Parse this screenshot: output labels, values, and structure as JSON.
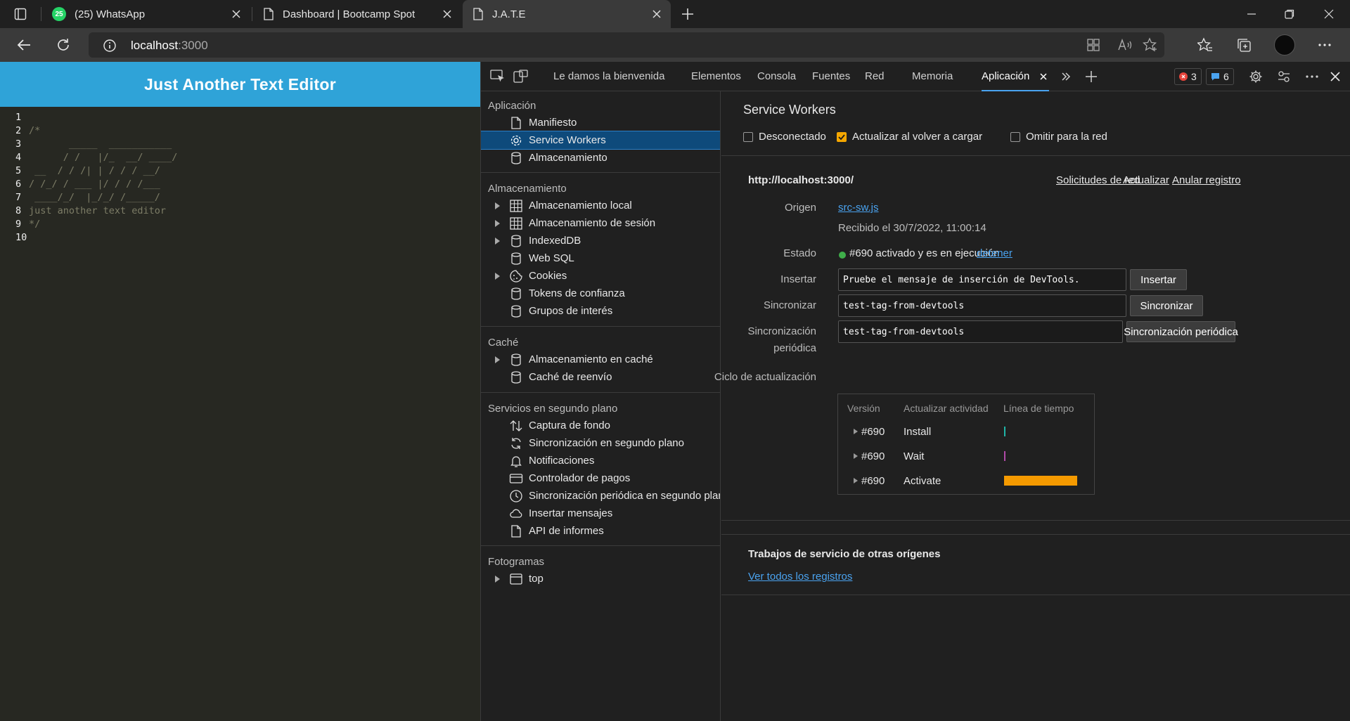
{
  "browser": {
    "tabs": [
      {
        "title": "(25) WhatsApp",
        "badge": "25"
      },
      {
        "title": "Dashboard | Bootcamp Spot"
      },
      {
        "title": "J.A.T.E"
      }
    ],
    "url_host": "localhost",
    "url_port": ":3000"
  },
  "app": {
    "header": "Just Another Text Editor",
    "code_lines": [
      {
        "n": "1",
        "t": ""
      },
      {
        "n": "2",
        "t": "/*"
      },
      {
        "n": "3",
        "t": "       _____  ___________"
      },
      {
        "n": "4",
        "t": "      / /   |/_  __/ ____/"
      },
      {
        "n": "5",
        "t": " __  / / /| | / / / __/"
      },
      {
        "n": "6",
        "t": "/ /_/ / ___ |/ / / /___"
      },
      {
        "n": "7",
        "t": " ____/_/  |_/_/ /_____/"
      },
      {
        "n": "8",
        "t": "just another text editor"
      },
      {
        "n": "9",
        "t": "*/"
      },
      {
        "n": "10",
        "t": ""
      }
    ]
  },
  "devtools": {
    "tabs": [
      "Le damos la bienvenida",
      "Elementos",
      "Consola",
      "Fuentes",
      "Red",
      "Memoria",
      "Aplicación"
    ],
    "errors": "3",
    "messages": "6",
    "sidebar": {
      "app_header": "Aplicación",
      "app_items": [
        "Manifiesto",
        "Service Workers",
        "Almacenamiento"
      ],
      "storage_header": "Almacenamiento",
      "storage_items": [
        "Almacenamiento local",
        "Almacenamiento de sesión",
        "IndexedDB",
        "Web SQL",
        "Cookies",
        "Tokens de confianza",
        "Grupos de interés"
      ],
      "cache_header": "Caché",
      "cache_items": [
        "Almacenamiento en caché",
        "Caché de reenvío"
      ],
      "bg_header": "Servicios en segundo plano",
      "bg_items": [
        "Captura de fondo",
        "Sincronización en segundo plano",
        "Notificaciones",
        "Controlador de pagos",
        "Sincronización periódica en segundo plano",
        "Insertar mensajes",
        "API de informes"
      ],
      "frames_header": "Fotogramas",
      "frames_items": [
        "top"
      ]
    },
    "sw": {
      "title": "Service Workers",
      "opt_offline": "Desconectado",
      "opt_update": "Actualizar al volver a cargar",
      "opt_bypass": "Omitir para la red",
      "scope": "http://localhost:3000/",
      "link_requests": "Solicitudes de red",
      "link_update": "Actualizar",
      "link_unregister": "Anular registro",
      "origin_label": "Origen",
      "origin_value": "src-sw.js",
      "received": "Recibido el 30/7/2022, 11:00:14",
      "status_label": "Estado",
      "status_value": "#690 activado y es en ejecución",
      "status_link": "detener",
      "push_label": "Insertar",
      "push_value": "Pruebe el mensaje de inserción de DevTools.",
      "push_button": "Insertar",
      "sync_label": "Sincronizar",
      "sync_value": "test-tag-from-devtools",
      "sync_button": "Sincronizar",
      "psync_label_1": "Sincronización",
      "psync_label_2": "periódica",
      "psync_value": "test-tag-from-devtools",
      "psync_button": "Sincronización periódica",
      "cycle_label": "Ciclo de actualización",
      "cycle_headers": [
        "Versión",
        "Actualizar actividad",
        "Línea de tiempo"
      ],
      "cycle_rows": [
        {
          "version": "#690",
          "activity": "Install",
          "color": "#1fb5a8"
        },
        {
          "version": "#690",
          "activity": "Wait",
          "color": "#b04aa8"
        },
        {
          "version": "#690",
          "activity": "Activate",
          "color": "#f59a00"
        }
      ],
      "other_title": "Trabajos de servicio de otras orígenes",
      "other_link": "Ver todos los registros"
    }
  }
}
